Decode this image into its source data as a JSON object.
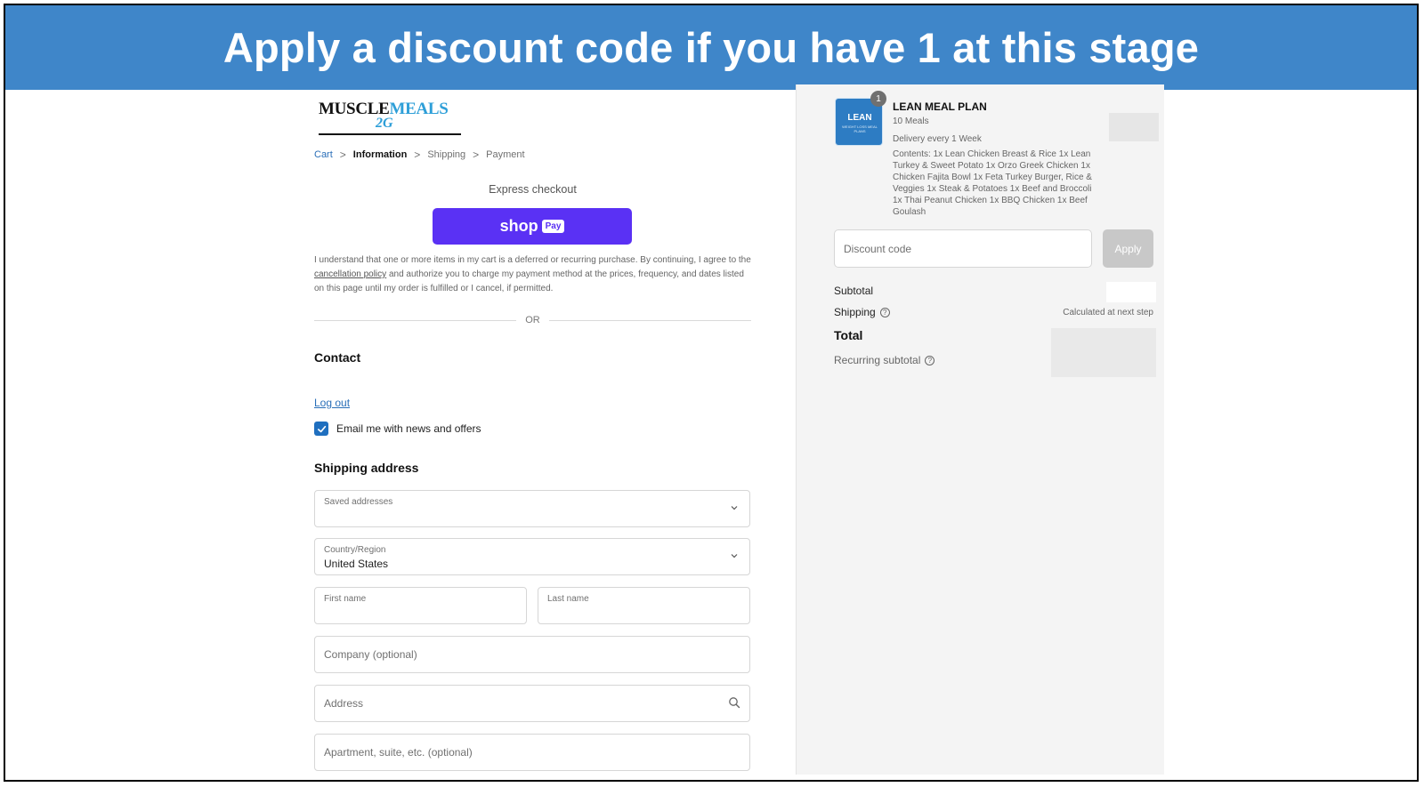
{
  "banner": {
    "title": "Apply a discount code if you have 1 at this stage",
    "color": "#3f86c9"
  },
  "logo": {
    "word1": "MUSCLE",
    "word2": "MEALS",
    "word3": "2G"
  },
  "breadcrumb": {
    "items": [
      "Cart",
      "Information",
      "Shipping",
      "Payment"
    ],
    "current": "Information",
    "separator": ">"
  },
  "express_checkout": {
    "label": "Express checkout",
    "shop_word": "shop",
    "pay_word": "Pay",
    "button_color": "#5a31f4"
  },
  "disclaimer": {
    "before_link": "I understand that one or more items in my cart is a deferred or recurring purchase. By continuing, I agree to the ",
    "link": "cancellation policy",
    "after_link": " and authorize you to charge my payment method at the prices, frequency, and dates listed on this page until my order is fulfilled or I cancel, if permitted."
  },
  "divider_text": "OR",
  "contact": {
    "heading": "Contact",
    "logout": "Log out",
    "newsletter_label": "Email me with news and offers",
    "newsletter_checked": true
  },
  "shipping_address": {
    "heading": "Shipping address",
    "saved_addresses_label": "Saved addresses",
    "country_label": "Country/Region",
    "country_value": "United States",
    "first_name_label": "First name",
    "last_name_label": "Last name",
    "company_placeholder": "Company (optional)",
    "address_placeholder": "Address",
    "apartment_placeholder": "Apartment, suite, etc. (optional)"
  },
  "order_summary": {
    "product": {
      "name": "LEAN MEAL PLAN",
      "quantity": "1",
      "variant": "10 Meals",
      "delivery": "Delivery every 1 Week",
      "contents": "Contents: 1x Lean Chicken Breast & Rice 1x Lean Turkey & Sweet Potato 1x Orzo Greek Chicken 1x Chicken Fajita Bowl 1x Feta Turkey Burger, Rice & Veggies 1x Steak & Potatoes 1x Beef and Broccoli 1x Thai Peanut Chicken 1x BBQ Chicken 1x Beef Goulash",
      "image_text": "LEAN",
      "image_subtext": "WEIGHT LOSS MEAL PLANS"
    },
    "discount_placeholder": "Discount code",
    "apply_label": "Apply",
    "subtotal_label": "Subtotal",
    "shipping_label": "Shipping",
    "shipping_value": "Calculated at next step",
    "total_label": "Total",
    "recurring_label": "Recurring subtotal"
  }
}
